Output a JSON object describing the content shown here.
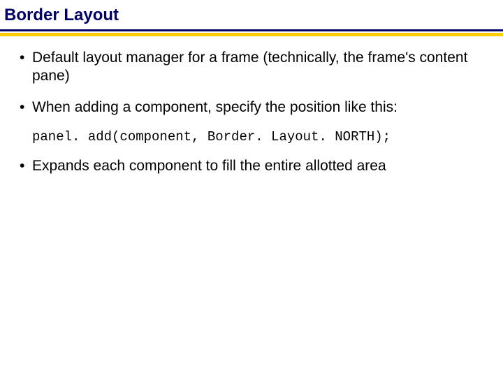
{
  "title": "Border Layout",
  "bullets": [
    "Default layout manager for a frame (technically, the frame's content pane)",
    "When adding a component, specify the position like this:"
  ],
  "code": "panel. add(component, Border. Layout. NORTH);",
  "bullets2": [
    "Expands each component to fill the entire allotted area"
  ]
}
